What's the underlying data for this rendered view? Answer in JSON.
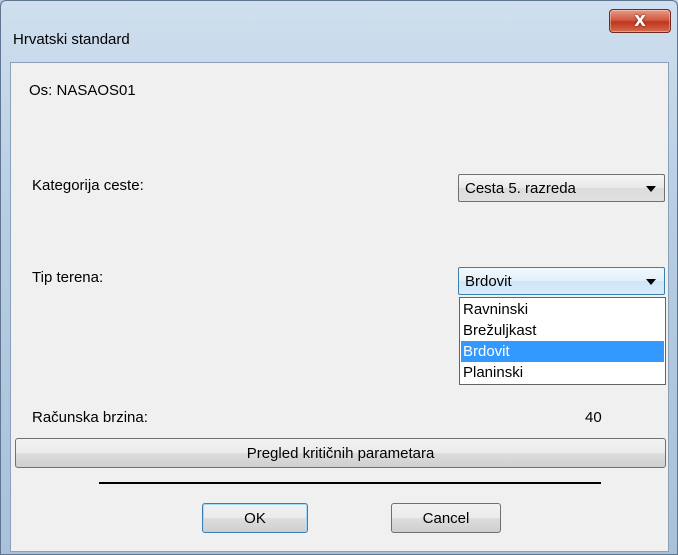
{
  "window": {
    "title": "Hrvatski standard",
    "close_glyph": "X"
  },
  "axis": {
    "label": "Os: NASAOS01"
  },
  "road_category": {
    "label": "Kategorija ceste:",
    "selected": "Cesta 5. razreda"
  },
  "terrain": {
    "label": "Tip terena:",
    "selected": "Brdovit",
    "options": [
      "Ravninski",
      "Brežuljkast",
      "Brdovit",
      "Planinski"
    ],
    "highlighted_index": 2
  },
  "design_speed": {
    "label": "Računska brzina:",
    "value": "40"
  },
  "buttons": {
    "review": "Pregled kritičnih parametara",
    "ok": "OK",
    "cancel": "Cancel"
  },
  "colors": {
    "selection": "#3399ff",
    "close_button": "#c7412b"
  }
}
